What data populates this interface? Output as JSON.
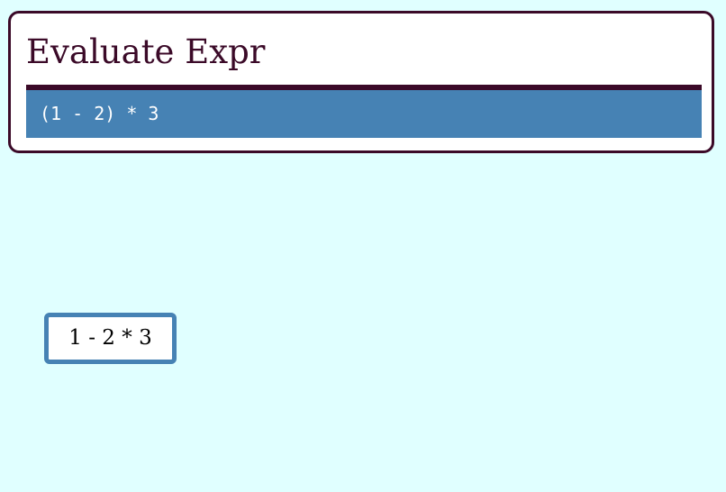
{
  "header": {
    "title": "Evaluate Expr",
    "expression": "(1 - 2) * 3"
  },
  "options": [
    {
      "label": "1 - 2 * 3"
    }
  ],
  "colors": {
    "page_background": "#e0ffff",
    "card_background": "#ffffff",
    "accent_dark": "#3b0a28",
    "expression_background": "#4682b4",
    "option_border": "#4682b4"
  }
}
